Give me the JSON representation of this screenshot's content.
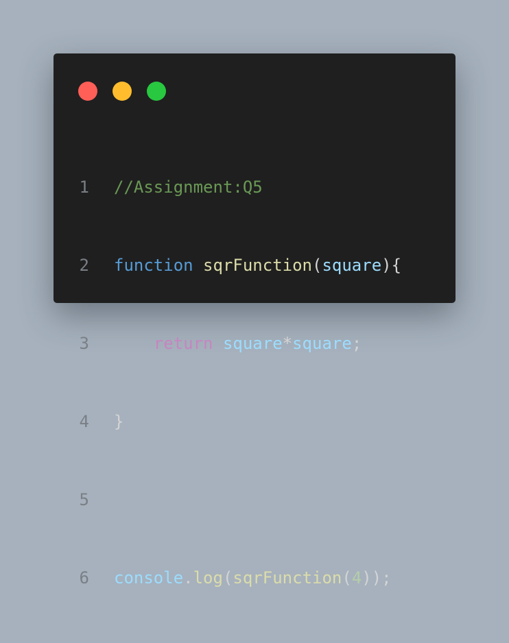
{
  "window": {
    "controls": [
      {
        "name": "close",
        "color": "#ff5f57"
      },
      {
        "name": "minimize",
        "color": "#ffbd2e"
      },
      {
        "name": "zoom",
        "color": "#28c840"
      }
    ]
  },
  "theme": {
    "comment": "#6a9955",
    "keyword": "#569cd6",
    "control": "#c586c0",
    "function": "#dcdcaa",
    "variable": "#9cdcfe",
    "punctuation": "#d4d4d4",
    "number": "#b5cea8"
  },
  "code": {
    "lines": [
      {
        "number": "1",
        "tokens": [
          {
            "text": "//Assignment:Q5",
            "kind": "comment"
          }
        ]
      },
      {
        "number": "2",
        "tokens": [
          {
            "text": "function",
            "kind": "keyword"
          },
          {
            "text": " ",
            "kind": "punctuation"
          },
          {
            "text": "sqrFunction",
            "kind": "function"
          },
          {
            "text": "(",
            "kind": "punctuation"
          },
          {
            "text": "square",
            "kind": "variable"
          },
          {
            "text": "){",
            "kind": "punctuation"
          }
        ]
      },
      {
        "number": "3",
        "tokens": [
          {
            "text": "    ",
            "kind": "punctuation"
          },
          {
            "text": "return",
            "kind": "control"
          },
          {
            "text": " ",
            "kind": "punctuation"
          },
          {
            "text": "square",
            "kind": "variable"
          },
          {
            "text": "*",
            "kind": "punctuation"
          },
          {
            "text": "square",
            "kind": "variable"
          },
          {
            "text": ";",
            "kind": "punctuation"
          }
        ]
      },
      {
        "number": "4",
        "tokens": [
          {
            "text": "}",
            "kind": "punctuation"
          }
        ]
      },
      {
        "number": "5",
        "tokens": []
      },
      {
        "number": "6",
        "tokens": [
          {
            "text": "console",
            "kind": "variable"
          },
          {
            "text": ".",
            "kind": "punctuation"
          },
          {
            "text": "log",
            "kind": "function"
          },
          {
            "text": "(",
            "kind": "punctuation"
          },
          {
            "text": "sqrFunction",
            "kind": "function"
          },
          {
            "text": "(",
            "kind": "punctuation"
          },
          {
            "text": "4",
            "kind": "number"
          },
          {
            "text": "));",
            "kind": "punctuation"
          }
        ]
      }
    ]
  }
}
